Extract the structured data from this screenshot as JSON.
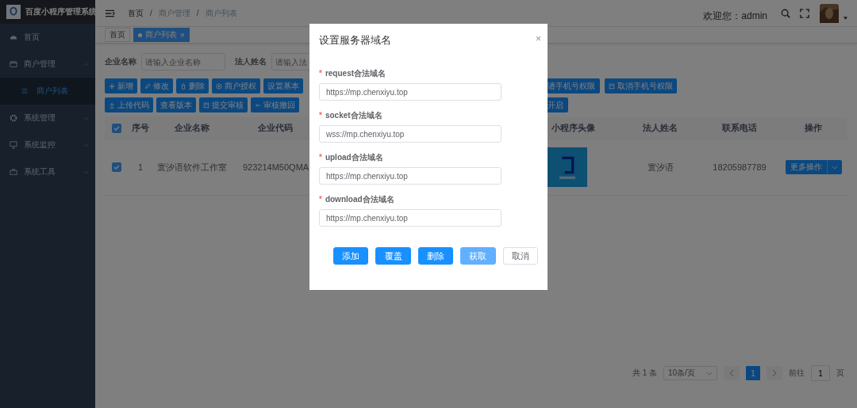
{
  "sidebar": {
    "title": "百度小程序管理系统",
    "items": [
      {
        "label": "首页",
        "kind": "link",
        "selected": false
      },
      {
        "label": "商户管理",
        "kind": "group",
        "expanded": true,
        "selected": false,
        "children": [
          {
            "label": "商户列表",
            "selected": true
          }
        ]
      },
      {
        "label": "系统管理",
        "kind": "group",
        "expanded": false,
        "selected": false
      },
      {
        "label": "系统监控",
        "kind": "group",
        "expanded": false,
        "selected": false
      },
      {
        "label": "系统工具",
        "kind": "group",
        "expanded": false,
        "selected": false
      }
    ]
  },
  "header": {
    "breadcrumb": [
      "首页",
      "商户管理",
      "商户列表"
    ],
    "separator": "/",
    "welcome": "欢迎您：admin"
  },
  "tags": [
    {
      "label": "首页",
      "selected": false
    },
    {
      "label": "商户列表",
      "selected": true,
      "close": "×"
    }
  ],
  "search_form": [
    {
      "label": "企业名称",
      "placeholder": "请输入企业名称"
    },
    {
      "label": "法人姓名",
      "placeholder": "请输入法"
    }
  ],
  "toolbar": [
    {
      "left": [
        {
          "label": "新增",
          "kind": "add"
        },
        {
          "label": "修改",
          "kind": "edit"
        },
        {
          "label": "删除",
          "kind": "delete"
        },
        {
          "label": "商户授权",
          "kind": "authorize"
        },
        {
          "label": "设置基本",
          "kind": "text"
        }
      ],
      "right": [
        {
          "label": "请手机号权限",
          "kind": "text"
        },
        {
          "label": "取消手机号权限",
          "kind": "document"
        }
      ]
    },
    {
      "left": [
        {
          "label": "上传代码",
          "kind": "upload"
        },
        {
          "label": "查看版本",
          "kind": "text"
        },
        {
          "label": "提交审核",
          "kind": "document"
        },
        {
          "label": "审核撤回",
          "kind": "revoke"
        }
      ],
      "right": [
        {
          "label": "开启",
          "kind": "text"
        }
      ]
    }
  ],
  "table": {
    "all_checked": true,
    "columns": [
      "序号",
      "企业名称",
      "企业代码",
      "小程序头像",
      "法人姓名",
      "联系电话",
      "操作"
    ],
    "rows": [
      {
        "checked": true,
        "cells": [
          "1",
          "寰汐语软件工作室",
          "923214M50QMA",
          "",
          "寰汐语",
          "18205987789"
        ],
        "action": "更多操作"
      }
    ]
  },
  "pagination": {
    "total": "共 1 条",
    "page_size": "10条/页",
    "pages": [
      {
        "label": "1",
        "selected": true
      }
    ],
    "goto": "前往",
    "goto_value": "1",
    "page_unit": "页"
  },
  "dialog": {
    "title": "设置服务器域名",
    "close": "×",
    "fields": [
      {
        "label": "request合法域名",
        "required_mark": "*",
        "value": "https://mp.chenxiyu.top"
      },
      {
        "label": "socket合法域名",
        "required_mark": "*",
        "value": "wss://mp.chenxiyu.top"
      },
      {
        "label": "upload合法域名",
        "required_mark": "*",
        "value": "https://mp.chenxiyu.top"
      },
      {
        "label": "download合法域名",
        "required_mark": "*",
        "value": "https://mp.chenxiyu.top"
      }
    ],
    "buttons": [
      {
        "label": "添加",
        "kind": "primary",
        "disabled": false
      },
      {
        "label": "覆盖",
        "kind": "primary",
        "disabled": false
      },
      {
        "label": "删除",
        "kind": "primary",
        "disabled": false
      },
      {
        "label": "获取",
        "kind": "primary",
        "disabled": true
      },
      {
        "label": "取消",
        "kind": "default",
        "disabled": false
      }
    ]
  }
}
